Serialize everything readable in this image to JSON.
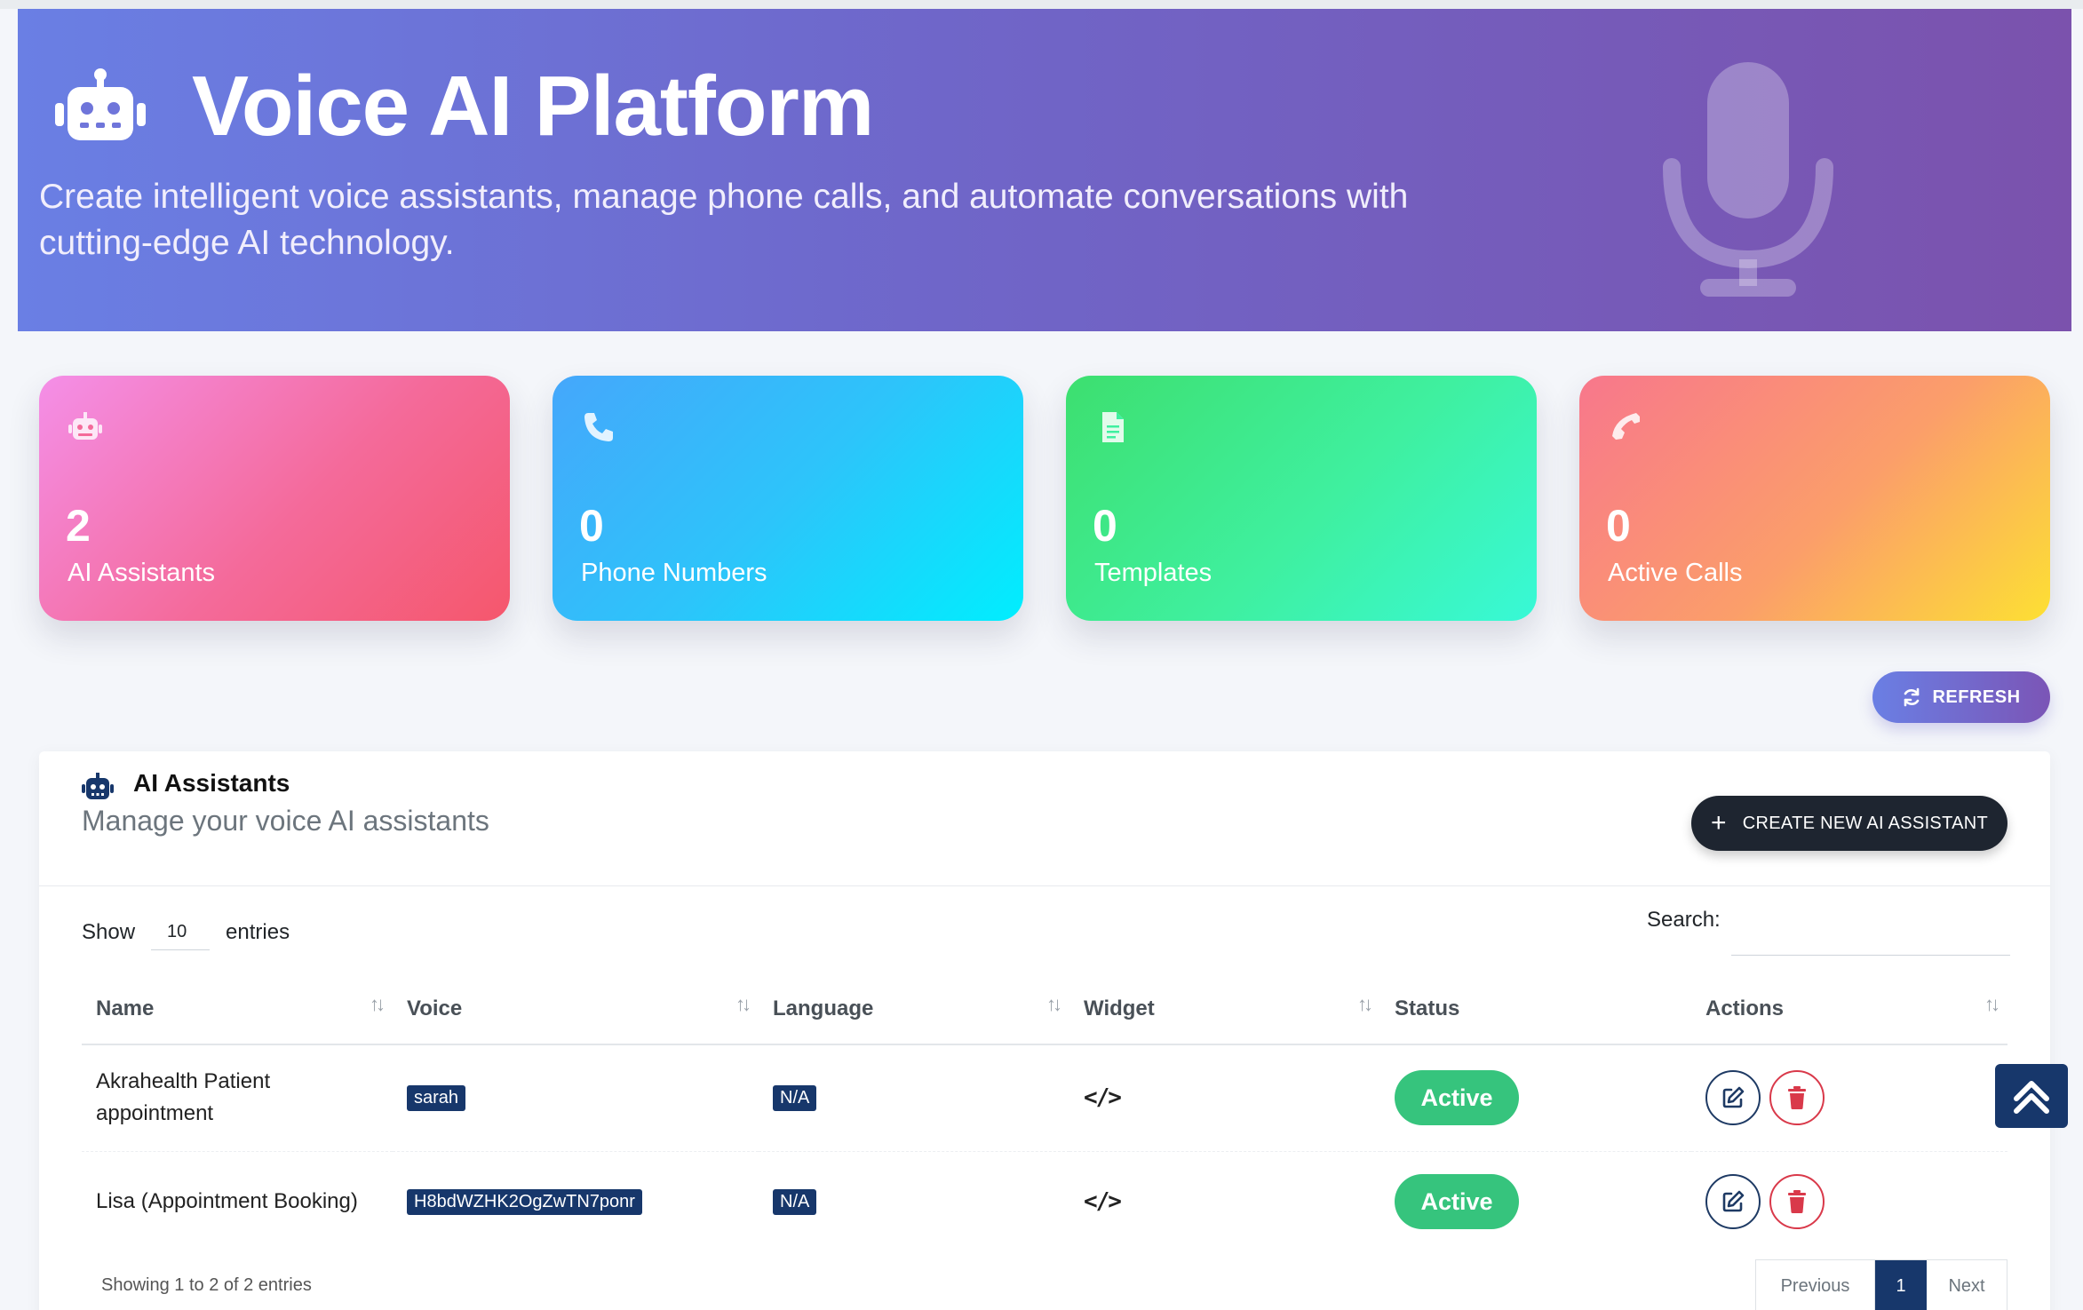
{
  "hero": {
    "title": "Voice AI Platform",
    "subtitle": "Create intelligent voice assistants, manage phone calls, and automate conversations with cutting-edge AI technology."
  },
  "stats": [
    {
      "value": "2",
      "label": "AI Assistants",
      "icon": "robot-icon"
    },
    {
      "value": "0",
      "label": "Phone Numbers",
      "icon": "phone-icon"
    },
    {
      "value": "0",
      "label": "Templates",
      "icon": "document-icon"
    },
    {
      "value": "0",
      "label": "Active Calls",
      "icon": "phone-call-icon"
    }
  ],
  "toolbar": {
    "refresh_label": "REFRESH"
  },
  "panel": {
    "title": "AI Assistants",
    "subtitle": "Manage your voice AI assistants",
    "create_label": "CREATE NEW AI ASSISTANT"
  },
  "table_controls": {
    "show_label": "Show",
    "entries_value": "10",
    "entries_label": "entries",
    "search_label": "Search:",
    "search_value": ""
  },
  "table": {
    "columns": [
      "Name",
      "Voice",
      "Language",
      "Widget",
      "Status",
      "Actions"
    ],
    "rows": [
      {
        "name": "Akrahealth Patient appointment",
        "voice": "sarah",
        "language": "N/A",
        "widget": "</>",
        "status": "Active"
      },
      {
        "name": "Lisa (Appointment Booking)",
        "voice": "H8bdWZHK2OgZwTN7ponr",
        "language": "N/A",
        "widget": "</>",
        "status": "Active"
      }
    ]
  },
  "footer": {
    "info": "Showing 1 to 2 of 2 entries",
    "prev_label": "Previous",
    "current_page": "1",
    "next_label": "Next"
  },
  "colors": {
    "hero_start": "#6a7fe4",
    "hero_end": "#7b52ad",
    "primary_dark": "#17376b",
    "status_active": "#36c47d",
    "delete_red": "#d9394a"
  }
}
